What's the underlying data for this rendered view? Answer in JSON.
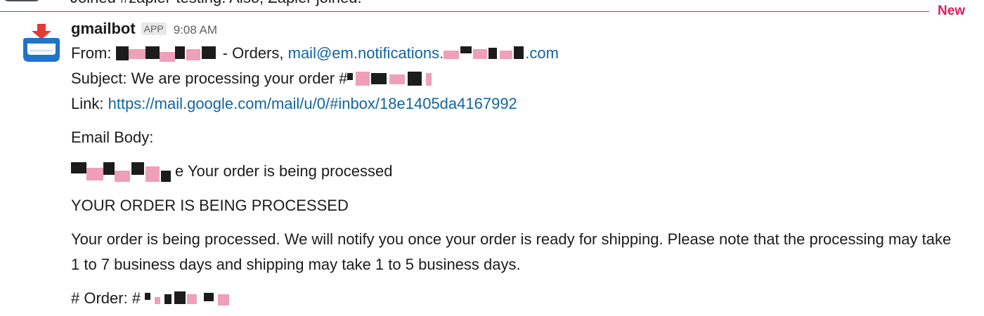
{
  "previous_message": {
    "text": "Joined #zapier-testing. Also, Zapier joined."
  },
  "new_divider": {
    "label": "New"
  },
  "message": {
    "sender": "gmailbot",
    "app_badge": "APP",
    "time": "9:08 AM",
    "from_label": "From:",
    "from_name_suffix": "- Orders,",
    "from_email_prefix": "mail@em.notifications.",
    "from_email_suffix": ".com",
    "subject_label": "Subject:",
    "subject_text": "We are processing your order #",
    "link_label": "Link:",
    "link_url": "https://mail.google.com/mail/u/0/#inbox/18e1405da4167992",
    "email_body_label": "Email Body:",
    "status_line_text": "e Your order is being processed",
    "heading": "YOUR ORDER IS BEING PROCESSED",
    "body_paragraph": "Your order is being processed. We will notify you once your order is ready for shipping. Please note that the processing may take 1 to 7 business days and shipping may take 1 to 5 business days.",
    "order_label": "# Order: #"
  },
  "colors": {
    "accent_new": "#e01e5a",
    "link": "#1264a3",
    "redaction_pink": "#ef9fb8",
    "redaction_dark": "#1d1c1d"
  },
  "icons": {
    "avatar": "gmail-inbox-icon"
  }
}
